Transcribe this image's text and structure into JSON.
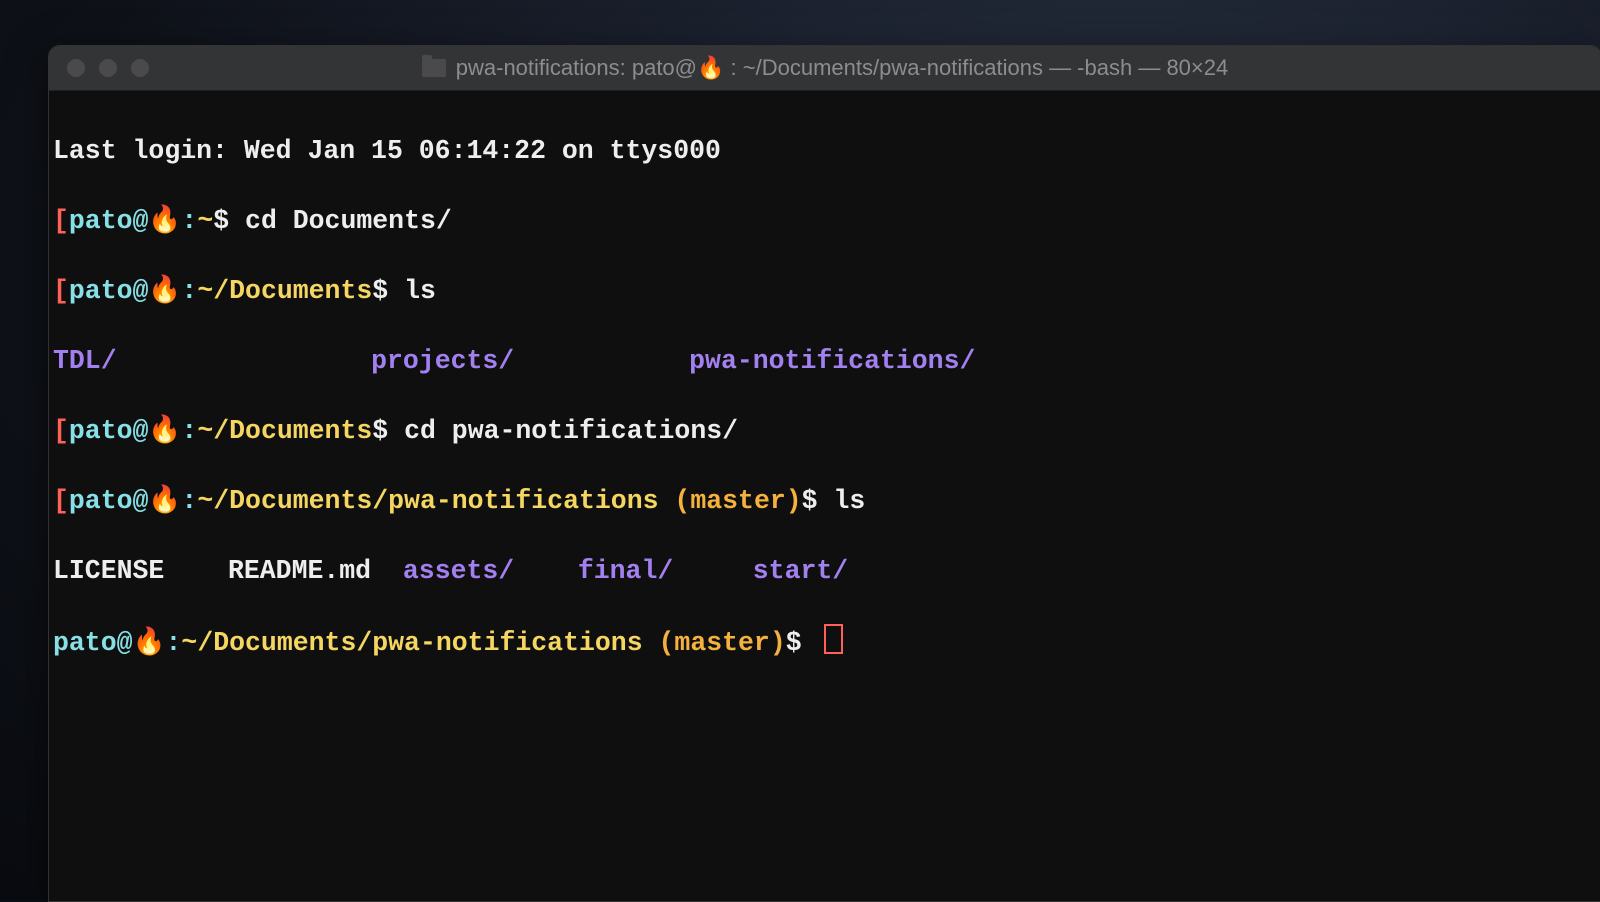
{
  "window": {
    "title_prefix": "pwa-notifications: pato@",
    "title_emoji": "🔥",
    "title_suffix": " : ~/Documents/pwa-notifications — -bash — 80×24"
  },
  "session": {
    "last_login": "Last login: Wed Jan 15 06:14:22 on ttys000",
    "prompt_user": "pato@",
    "prompt_emoji": "🔥",
    "prompt_sep": ":",
    "dollar": "$ ",
    "paths": {
      "home": "~",
      "docs": "~/Documents",
      "repo": "~/Documents/pwa-notifications"
    },
    "branch_open": " (",
    "branch": "master",
    "branch_close": ")",
    "bracket_open": "[",
    "cmd1": "cd Documents/",
    "cmd2": "ls",
    "cmd3": "cd pwa-notifications/",
    "cmd4": "ls",
    "ls1": {
      "c1": "TDL/",
      "c2": "projects/",
      "c3": "pwa-notifications/"
    },
    "ls2": {
      "f1": "LICENSE",
      "f2": "README.md",
      "d1": "assets/",
      "d2": "final/",
      "d3": "start/"
    }
  }
}
